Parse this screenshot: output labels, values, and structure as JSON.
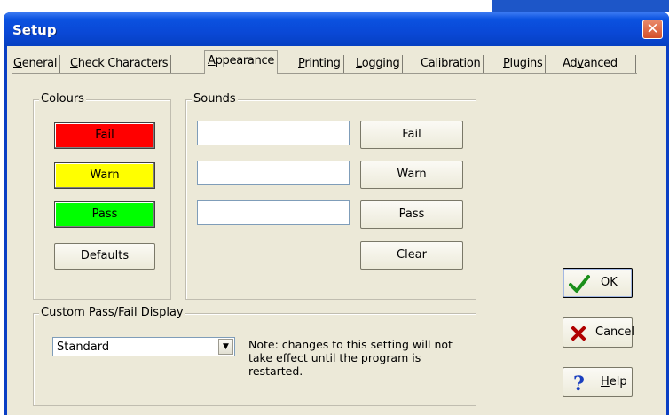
{
  "window": {
    "title": "Setup",
    "close_glyph": "✕"
  },
  "tabs": [
    {
      "label": "General",
      "mnemonic": "G",
      "rest": "eneral"
    },
    {
      "label": "Check Characters",
      "mnemonic": "C",
      "rest": "heck Characters"
    },
    {
      "label": "Appearance",
      "mnemonic": "A",
      "rest": "ppearance",
      "active": true
    },
    {
      "label": "Printing",
      "mnemonic": "P",
      "rest": "rinting"
    },
    {
      "label": "Logging",
      "mnemonic": "L",
      "rest": "ogging"
    },
    {
      "label": "Calibration",
      "mnemonic": "",
      "rest": "Calibration"
    },
    {
      "label": "Plugins",
      "mnemonic": "P",
      "rest": "lugins"
    },
    {
      "label": "Advanced",
      "pre": "Ad",
      "mnemonic": "v",
      "rest": "anced"
    }
  ],
  "colours": {
    "legend": "Colours",
    "fail": {
      "label": "Fail",
      "color": "#ff0000"
    },
    "warn": {
      "label": "Warn",
      "color": "#ffff00"
    },
    "pass": {
      "label": "Pass",
      "color": "#00ff00"
    },
    "defaults_label": "Defaults"
  },
  "sounds": {
    "legend": "Sounds",
    "fail_value": "",
    "warn_value": "",
    "pass_value": "",
    "fail_label": "Fail",
    "warn_label": "Warn",
    "pass_label": "Pass",
    "clear_label": "Clear"
  },
  "custom_display": {
    "legend": "Custom Pass/Fail Display",
    "selected": "Standard",
    "note": "Note: changes to this setting will not take effect until the program is restarted."
  },
  "actions": {
    "ok_label": "OK",
    "cancel_label": "Cancel",
    "help_mnemonic": "H",
    "help_rest": "elp",
    "help_label": "Help"
  },
  "icons": {
    "ok": "checkmark-icon",
    "cancel": "red-x-icon",
    "help": "question-mark-icon"
  }
}
